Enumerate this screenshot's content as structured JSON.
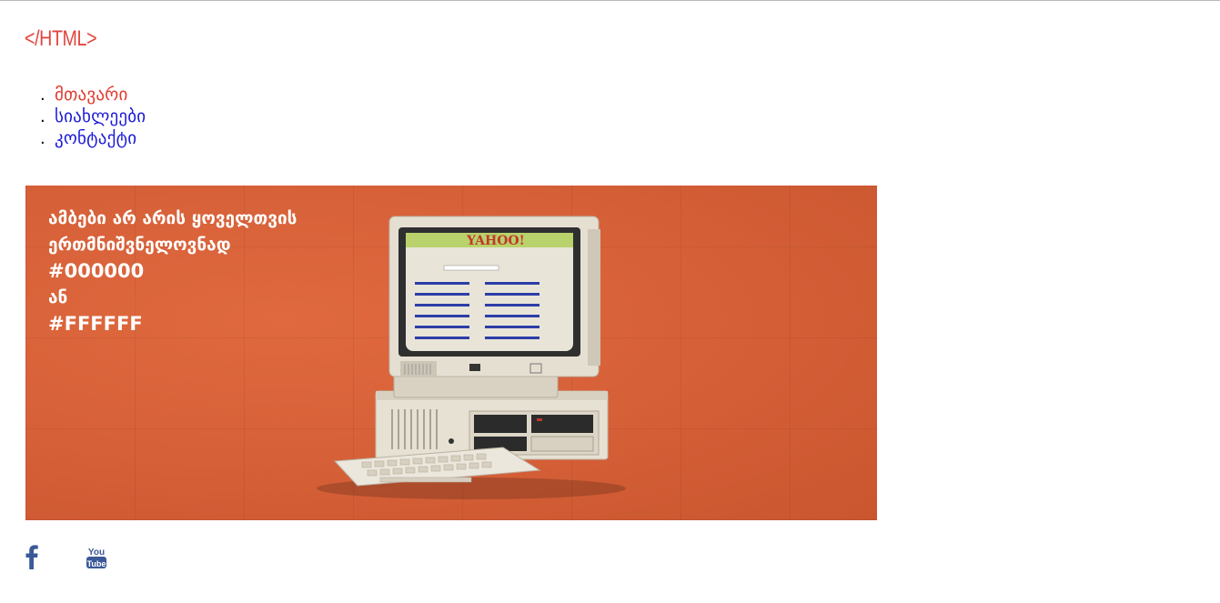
{
  "header": {
    "logo_text": "</HTML>"
  },
  "nav": {
    "items": [
      {
        "label": "მთავარი",
        "active": true
      },
      {
        "label": "სიახლეები",
        "active": false
      },
      {
        "label": "კონტაქტი",
        "active": false
      }
    ]
  },
  "banner": {
    "line1": "ამბები არ არის ყოველთვის",
    "line2": "ერთმნიშვნელოვნად",
    "line3": "#000000",
    "line4": "ან",
    "line5": "#FFFFFF",
    "screen_logo": "YAHOO!"
  },
  "social": {
    "facebook_icon": "facebook-icon",
    "youtube_icon": "youtube-icon",
    "youtube_top": "You",
    "youtube_bottom": "Tube"
  },
  "colors": {
    "accent": "#e2453f",
    "link": "#1b1bd6",
    "banner_bg": "#d9633c",
    "icon": "#3b5998"
  }
}
